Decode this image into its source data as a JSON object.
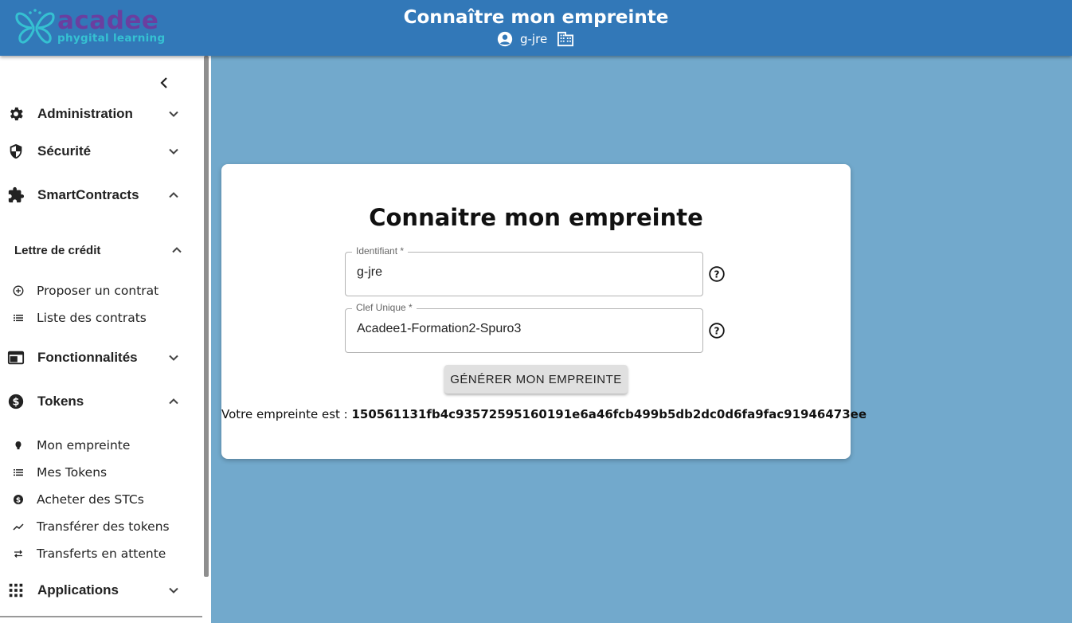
{
  "header": {
    "logo_name": "acadee",
    "logo_tagline": "phygital learning",
    "title": "Connaître mon empreinte",
    "username": "g-jre",
    "user_icon": "account-circle-icon",
    "org_icon": "building-icon"
  },
  "sidebar": {
    "collapse_icon": "chevron-left-icon",
    "items": [
      {
        "label": "Administration",
        "icon": "gear-icon",
        "expanded": false
      },
      {
        "label": "Sécurité",
        "icon": "shield-icon",
        "expanded": false
      },
      {
        "label": "SmartContracts",
        "icon": "puzzle-icon",
        "expanded": true
      },
      {
        "label": "Fonctionnalités",
        "icon": "web-icon",
        "expanded": false
      },
      {
        "label": "Tokens",
        "icon": "dollar-circle-icon",
        "expanded": true
      },
      {
        "label": "Applications",
        "icon": "apps-grid-icon",
        "expanded": false
      }
    ],
    "smartcontracts_group": {
      "label": "Lettre de crédit",
      "expanded": true,
      "items": [
        {
          "label": "Proposer un contrat",
          "icon": "add-circle-icon"
        },
        {
          "label": "Liste des contrats",
          "icon": "list-icon"
        }
      ]
    },
    "tokens_items": [
      {
        "label": "Mon empreinte",
        "icon": "fingerprint-icon"
      },
      {
        "label": "Mes Tokens",
        "icon": "list-icon"
      },
      {
        "label": "Acheter des STCs",
        "icon": "dollar-circle-icon"
      },
      {
        "label": "Transférer des tokens",
        "icon": "trending-icon"
      },
      {
        "label": "Transferts en attente",
        "icon": "swap-icon"
      }
    ]
  },
  "card": {
    "title": "Connaitre mon empreinte",
    "identifiant_label": "Identifiant *",
    "identifiant_value": "g-jre",
    "clef_label": "Clef Unique *",
    "clef_value": "Acadee1-Formation2-Spuro3",
    "button_label": "GÉNÉRER MON EMPREINTE",
    "result_prefix": "Votre empreinte est :",
    "result_value": "150561131fb4c93572595160191e6a46fcb499b5db2dc0d6fa9fac91946473ee"
  },
  "colors": {
    "header": "#3278b8",
    "background": "#72a9cc",
    "logo_purple": "#6a3fa0",
    "logo_cyan": "#35c1d2"
  }
}
